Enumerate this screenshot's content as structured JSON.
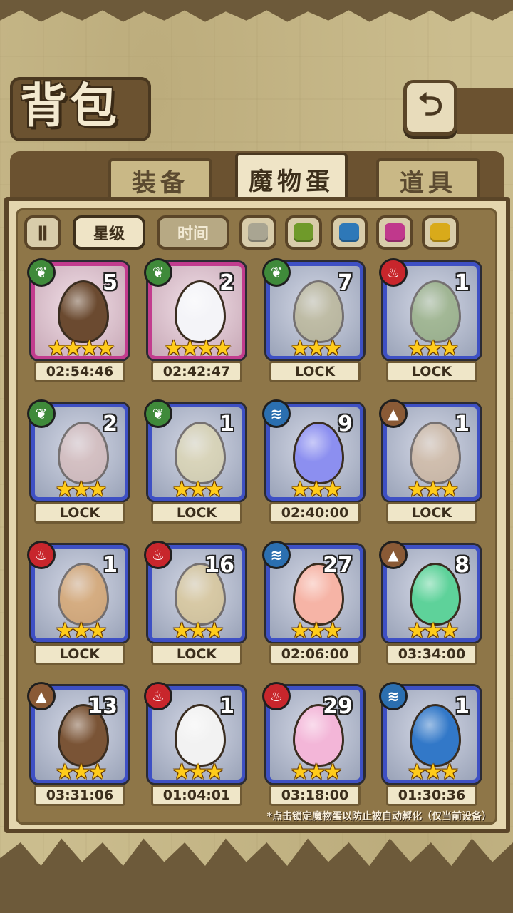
{
  "title": "背包",
  "back_icon": "undo-arrow-icon",
  "tabs": [
    {
      "label": "装备",
      "active": false
    },
    {
      "label": "魔物蛋",
      "active": true
    },
    {
      "label": "道具",
      "active": false
    }
  ],
  "filters": {
    "sort_toggle_icon": "pause-toggle-icon",
    "star_label": "星级",
    "time_label": "时间",
    "swatches": [
      "#a9a592",
      "#6f9a2a",
      "#2e78b8",
      "#c0388c",
      "#d9aa1a"
    ]
  },
  "eggs": [
    {
      "element": "leaf",
      "count": "5",
      "stars": 4,
      "status": "02:54:46",
      "rare": true,
      "locked": false,
      "color": "#6b4a30"
    },
    {
      "element": "leaf",
      "count": "2",
      "stars": 4,
      "status": "02:42:47",
      "rare": true,
      "locked": false,
      "color": "#f4f4f8"
    },
    {
      "element": "leaf",
      "count": "7",
      "stars": 3,
      "status": "LOCK",
      "rare": false,
      "locked": true,
      "color": "#b9b07a"
    },
    {
      "element": "fire",
      "count": "1",
      "stars": 3,
      "status": "LOCK",
      "rare": false,
      "locked": true,
      "color": "#86a85e"
    },
    {
      "element": "leaf",
      "count": "2",
      "stars": 3,
      "status": "LOCK",
      "rare": false,
      "locked": true,
      "color": "#e0b8b0"
    },
    {
      "element": "leaf",
      "count": "1",
      "stars": 3,
      "status": "LOCK",
      "rare": false,
      "locked": true,
      "color": "#e8dca0"
    },
    {
      "element": "water",
      "count": "9",
      "stars": 3,
      "status": "02:40:00",
      "rare": false,
      "locked": false,
      "color": "#8c8ff0"
    },
    {
      "element": "earth",
      "count": "1",
      "stars": 3,
      "status": "LOCK",
      "rare": false,
      "locked": true,
      "color": "#d8b48a"
    },
    {
      "element": "fire",
      "count": "1",
      "stars": 3,
      "status": "LOCK",
      "rare": false,
      "locked": true,
      "color": "#e2953a"
    },
    {
      "element": "fire",
      "count": "16",
      "stars": 3,
      "status": "LOCK",
      "rare": false,
      "locked": true,
      "color": "#e6c87a"
    },
    {
      "element": "water",
      "count": "27",
      "stars": 3,
      "status": "02:06:00",
      "rare": false,
      "locked": false,
      "color": "#f6b4a6"
    },
    {
      "element": "earth",
      "count": "8",
      "stars": 3,
      "status": "03:34:00",
      "rare": false,
      "locked": false,
      "color": "#5ed29a"
    },
    {
      "element": "earth",
      "count": "13",
      "stars": 3,
      "status": "03:31:06",
      "rare": false,
      "locked": false,
      "color": "#7a5436"
    },
    {
      "element": "fire",
      "count": "1",
      "stars": 3,
      "status": "01:04:01",
      "rare": false,
      "locked": false,
      "color": "#f2f2f2"
    },
    {
      "element": "fire",
      "count": "29",
      "stars": 3,
      "status": "03:18:00",
      "rare": false,
      "locked": false,
      "color": "#f3b6d8"
    },
    {
      "element": "water",
      "count": "1",
      "stars": 3,
      "status": "01:30:36",
      "rare": false,
      "locked": false,
      "color": "#3278c8"
    }
  ],
  "element_icons": {
    "leaf": "leaf-icon",
    "fire": "flame-icon",
    "water": "wave-icon",
    "earth": "mountain-icon"
  },
  "footer_note": "*点击锁定魔物蛋以防止被自动孵化（仅当前设备）"
}
